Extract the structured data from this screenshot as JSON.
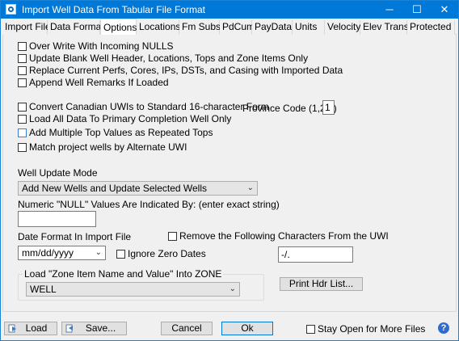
{
  "window": {
    "title": "Import Well Data From Tabular File Format",
    "controls": {
      "minimize": "─",
      "maximize": "☐",
      "close": "✕"
    }
  },
  "tabs": [
    {
      "label": "Import File"
    },
    {
      "label": "Data Format"
    },
    {
      "label": "Options",
      "active": true
    },
    {
      "label": "Locations"
    },
    {
      "label": "Fm Subst"
    },
    {
      "label": "PdCum"
    },
    {
      "label": "PayData"
    },
    {
      "label": "Units"
    },
    {
      "label": "Velocity"
    },
    {
      "label": "Elev Trans"
    },
    {
      "label": "Protected"
    }
  ],
  "options": {
    "overwrite_nulls": {
      "label": "Over  Write With Incoming NULLS",
      "checked": false
    },
    "update_blank_header": {
      "label": "Update Blank Well Header, Locations, Tops and Zone Items Only",
      "checked": false
    },
    "replace_perfs": {
      "label": "Replace Current Perfs, Cores, IPs, DSTs, and Casing with Imported Data",
      "checked": false
    },
    "append_remarks": {
      "label": "Append Well Remarks If Loaded",
      "checked": false
    },
    "convert_canadian_uwi": {
      "label": "Convert Canadian UWIs to Standard 16-character Form",
      "checked": false
    },
    "province_code_label": "Province Code (1,2,3)",
    "province_code_value": "1",
    "load_primary_completion": {
      "label": "Load All Data To Primary Completion Well Only",
      "checked": false
    },
    "add_multiple_tops": {
      "label": "Add Multiple Top Values as Repeated Tops",
      "checked": false
    },
    "match_alternate_uwi": {
      "label": "Match project wells by Alternate UWI",
      "checked": false
    },
    "well_update_mode_label": "Well Update Mode",
    "well_update_mode_value": "Add New Wells and Update Selected Wells",
    "null_values_label": "Numeric \"NULL\" Values Are Indicated By:  (enter exact string)",
    "null_values_value": "",
    "date_format_label": "Date Format  In Import File",
    "date_format_value": "mm/dd/yyyy",
    "ignore_zero_dates": {
      "label": "Ignore Zero Dates",
      "checked": false
    },
    "remove_chars": {
      "label": "Remove the Following Characters From the UWI",
      "checked": false
    },
    "remove_chars_value": "-/.",
    "zone_group_label": "Load \"Zone Item Name and Value\" Into ZONE",
    "zone_value": "WELL",
    "print_hdr_list_label": "Print Hdr List..."
  },
  "footer": {
    "load_label": "Load",
    "save_label": "Save...",
    "cancel_label": "Cancel",
    "ok_label": "Ok",
    "stay_open": {
      "label": "Stay Open for More Files",
      "checked": false
    },
    "help_glyph": "?"
  },
  "colors": {
    "titlebar": "#0078d7",
    "accent_border": "#0078d7",
    "help_icon": "#2e6dcf"
  }
}
